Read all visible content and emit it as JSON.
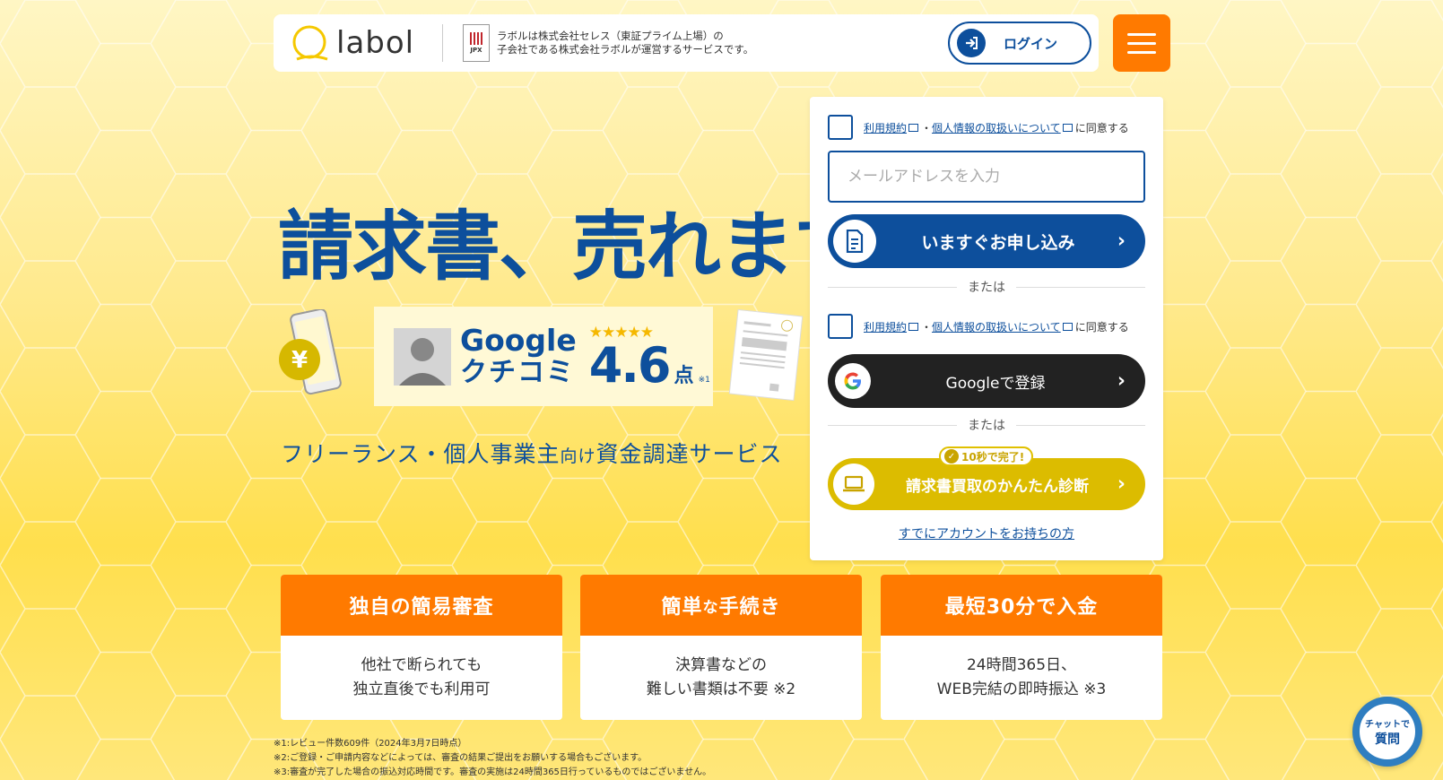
{
  "header": {
    "logo_text": "labol",
    "jpx_label": "JPX",
    "company_note_line1": "ラボルは株式会社セレス（東証プライム上場）の",
    "company_note_line2": "子会社である株式会社ラボルが運営するサービスです。",
    "login_label": "ログイン"
  },
  "hero": {
    "headline": "請求書、売れます",
    "review_google": "Google",
    "review_kuchikomi": "クチコミ",
    "stars": "★★★★★",
    "rating": "4.6",
    "rating_unit": "点",
    "rating_note": "※1",
    "tagline_a": "フリーランス・個人事業主",
    "tagline_b": "向け",
    "tagline_c": "資金調達サービス"
  },
  "form": {
    "terms_link": "利用規約",
    "dot": "・",
    "privacy_link": "個人情報の取扱いについて",
    "agree_suffix": "に同意する",
    "email_placeholder": "メールアドレスを入力",
    "apply_label": "いますぐお申し込み",
    "or_label": "または",
    "google_label": "Googleで登録",
    "speed_badge": "10秒で完了!",
    "diagnosis_label": "請求書買取のかんたん診断",
    "have_account": "すでにアカウントをお持ちの方"
  },
  "features": [
    {
      "title_a": "独自の簡易審査",
      "title_b": "",
      "title_c": "",
      "line1": "他社で断られても",
      "line2": "独立直後でも利用可"
    },
    {
      "title_a": "簡単",
      "title_b": "な",
      "title_c": "手続き",
      "line1": "決算書などの",
      "line2": "難しい書類は不要 ※2"
    },
    {
      "title_a": "最短30分で入金",
      "title_b": "",
      "title_c": "",
      "line1": "24時間365日、",
      "line2": "WEB完結の即時振込 ※3"
    }
  ],
  "footnotes": [
    "※1:レビュー件数609件（2024年3月7日時点）",
    "※2:ご登録・ご申請内容などによっては、審査の結果ご提出をお願いする場合もございます。",
    "※3:審査が完了した場合の振込対応時間です。審査の実施は24時間365日行っているものではございません。"
  ],
  "chat": {
    "line1": "チャットで",
    "line2": "質問"
  },
  "colors": {
    "brand_blue": "#0d4f9c",
    "orange": "#ff7a00",
    "yellow": "#e0b800",
    "google_black": "#222222"
  }
}
